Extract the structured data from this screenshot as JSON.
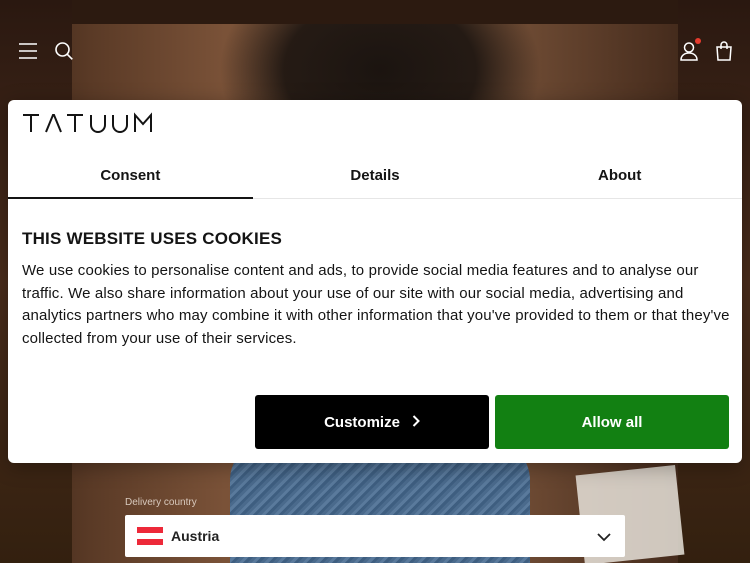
{
  "header": {
    "menu_icon": "hamburger-menu-icon",
    "search_icon": "search-icon",
    "account_icon": "user-icon",
    "cart_icon": "shopping-bag-icon",
    "notification_color": "#e63b2e"
  },
  "cookie_dialog": {
    "brand": "TATUUM",
    "tabs": [
      {
        "label": "Consent",
        "active": true
      },
      {
        "label": "Details",
        "active": false
      },
      {
        "label": "About",
        "active": false
      }
    ],
    "title": "THIS WEBSITE USES COOKIES",
    "body": "We use cookies to personalise content and ads, to provide social media features and to analyse our traffic. We also share information about your use of our site with our social media, advertising and analytics partners who may combine it with other information that you've provided to them or that they've collected from your use of their services.",
    "customize_label": "Customize",
    "allow_all_label": "Allow all",
    "allow_color": "#128012"
  },
  "delivery": {
    "label": "Delivery country",
    "selected_country": "Austria",
    "flag_colors": [
      "#ed2939",
      "#ffffff",
      "#ed2939"
    ]
  }
}
